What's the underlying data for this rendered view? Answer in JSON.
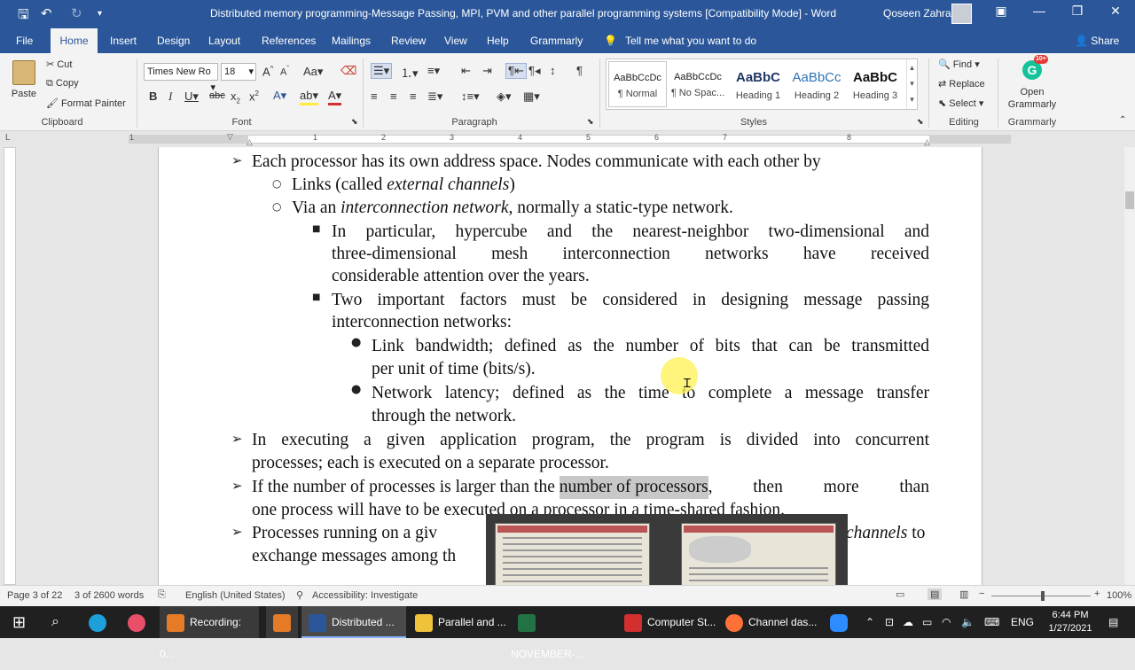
{
  "titlebar": {
    "document_title": "Distributed memory programming-Message Passing, MPI, PVM and other parallel programming systems [Compatibility Mode]  -  Word",
    "user": "Qoseen Zahra"
  },
  "menu": {
    "file": "File",
    "home": "Home",
    "insert": "Insert",
    "design": "Design",
    "layout": "Layout",
    "references": "References",
    "mailings": "Mailings",
    "review": "Review",
    "view": "View",
    "help": "Help",
    "grammarly": "Grammarly",
    "tell_me": "Tell me what you want to do",
    "share": "Share"
  },
  "ribbon": {
    "clipboard": {
      "paste": "Paste",
      "cut": "Cut",
      "copy": "Copy",
      "format_painter": "Format Painter",
      "group": "Clipboard"
    },
    "font": {
      "name": "Times New Ro",
      "size": "18",
      "group": "Font"
    },
    "paragraph": {
      "group": "Paragraph"
    },
    "styles": {
      "group": "Styles",
      "items": [
        {
          "preview": "AaBbCcDc",
          "name": "¶ Normal"
        },
        {
          "preview": "AaBbCcDc",
          "name": "¶ No Spac..."
        },
        {
          "preview": "AaBbC",
          "name": "Heading 1"
        },
        {
          "preview": "AaBbCc",
          "name": "Heading 2"
        },
        {
          "preview": "AaBbC",
          "name": "Heading 3"
        }
      ]
    },
    "editing": {
      "find": "Find",
      "replace": "Replace",
      "select": "Select",
      "group": "Editing"
    },
    "grammarly": {
      "open": "Open",
      "name": "Grammarly",
      "group": "Grammarly",
      "badge": "10+"
    }
  },
  "ruler_numbers": [
    "1",
    "1",
    "2",
    "3",
    "4",
    "5",
    "6",
    "7",
    "8"
  ],
  "document": {
    "l1": "Each processor has its own address space. Nodes communicate with each other by",
    "l2a": "Links (called ",
    "l2b": "external channels",
    "l2c": ")",
    "l3a": "Via an ",
    "l3b": "interconnection network",
    "l3c": ", normally a static-type network.",
    "l4": "In particular, hypercube and the nearest-neighbor two-dimensional and",
    "l5": "three-dimensional mesh interconnection networks have received",
    "l6": "considerable attention over the years.",
    "l7": "Two important factors must be considered in designing message passing",
    "l8": "interconnection networks:",
    "l9": "Link bandwidth; defined as the number of bits that can be transmitted",
    "l10": "per unit of time (bits/s).",
    "l11": "Network latency; defined as the time to complete a message transfer",
    "l12": "through the network.",
    "l13": "In executing a given application program, the program is divided into concurrent",
    "l14": "processes; each is executed on a separate processor.",
    "l15a": "If the number of processes is larger than the ",
    "l15b": "number of processors",
    "l15c": ", then more than",
    "l16": "one process will have to be executed on a processor in a time-shared fashion.",
    "l17a": "Processes running on a giv",
    "l17b": "channels",
    "l17c": " to",
    "l18": "exchange messages among th"
  },
  "status": {
    "page": "Page 3 of 22",
    "words": "3 of 2600 words",
    "language": "English (United States)",
    "accessibility": "Accessibility: Investigate",
    "zoom": "100%"
  },
  "taskbar": {
    "recording": "Recording: 0...",
    "word": "Distributed ...",
    "folder": "Parallel and ...",
    "excel": "NOVEMBER-...",
    "pdf": "Computer St...",
    "firefox": "Channel das...",
    "lang": "ENG",
    "time": "6:44 PM",
    "date": "1/27/2021"
  },
  "colors": {
    "word_blue": "#2b579a",
    "highlight": "#c8c8c8",
    "cursor": "#fff050"
  }
}
